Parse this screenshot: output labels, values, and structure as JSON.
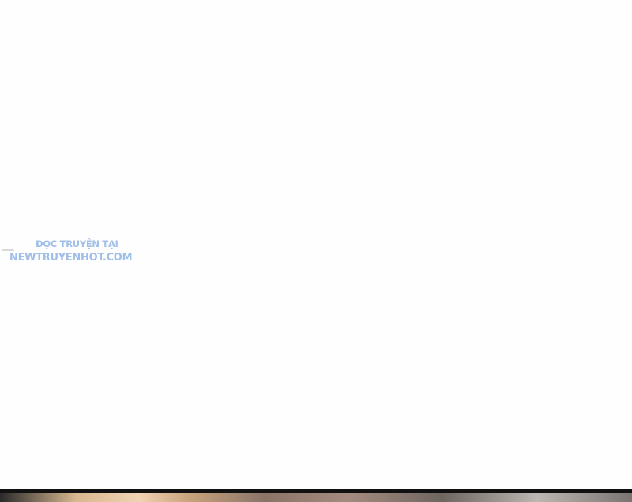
{
  "watermark": {
    "line1": "ĐỌC TRUYỆN TẠI",
    "line2": "NEWTRUYENHOT.COM"
  }
}
